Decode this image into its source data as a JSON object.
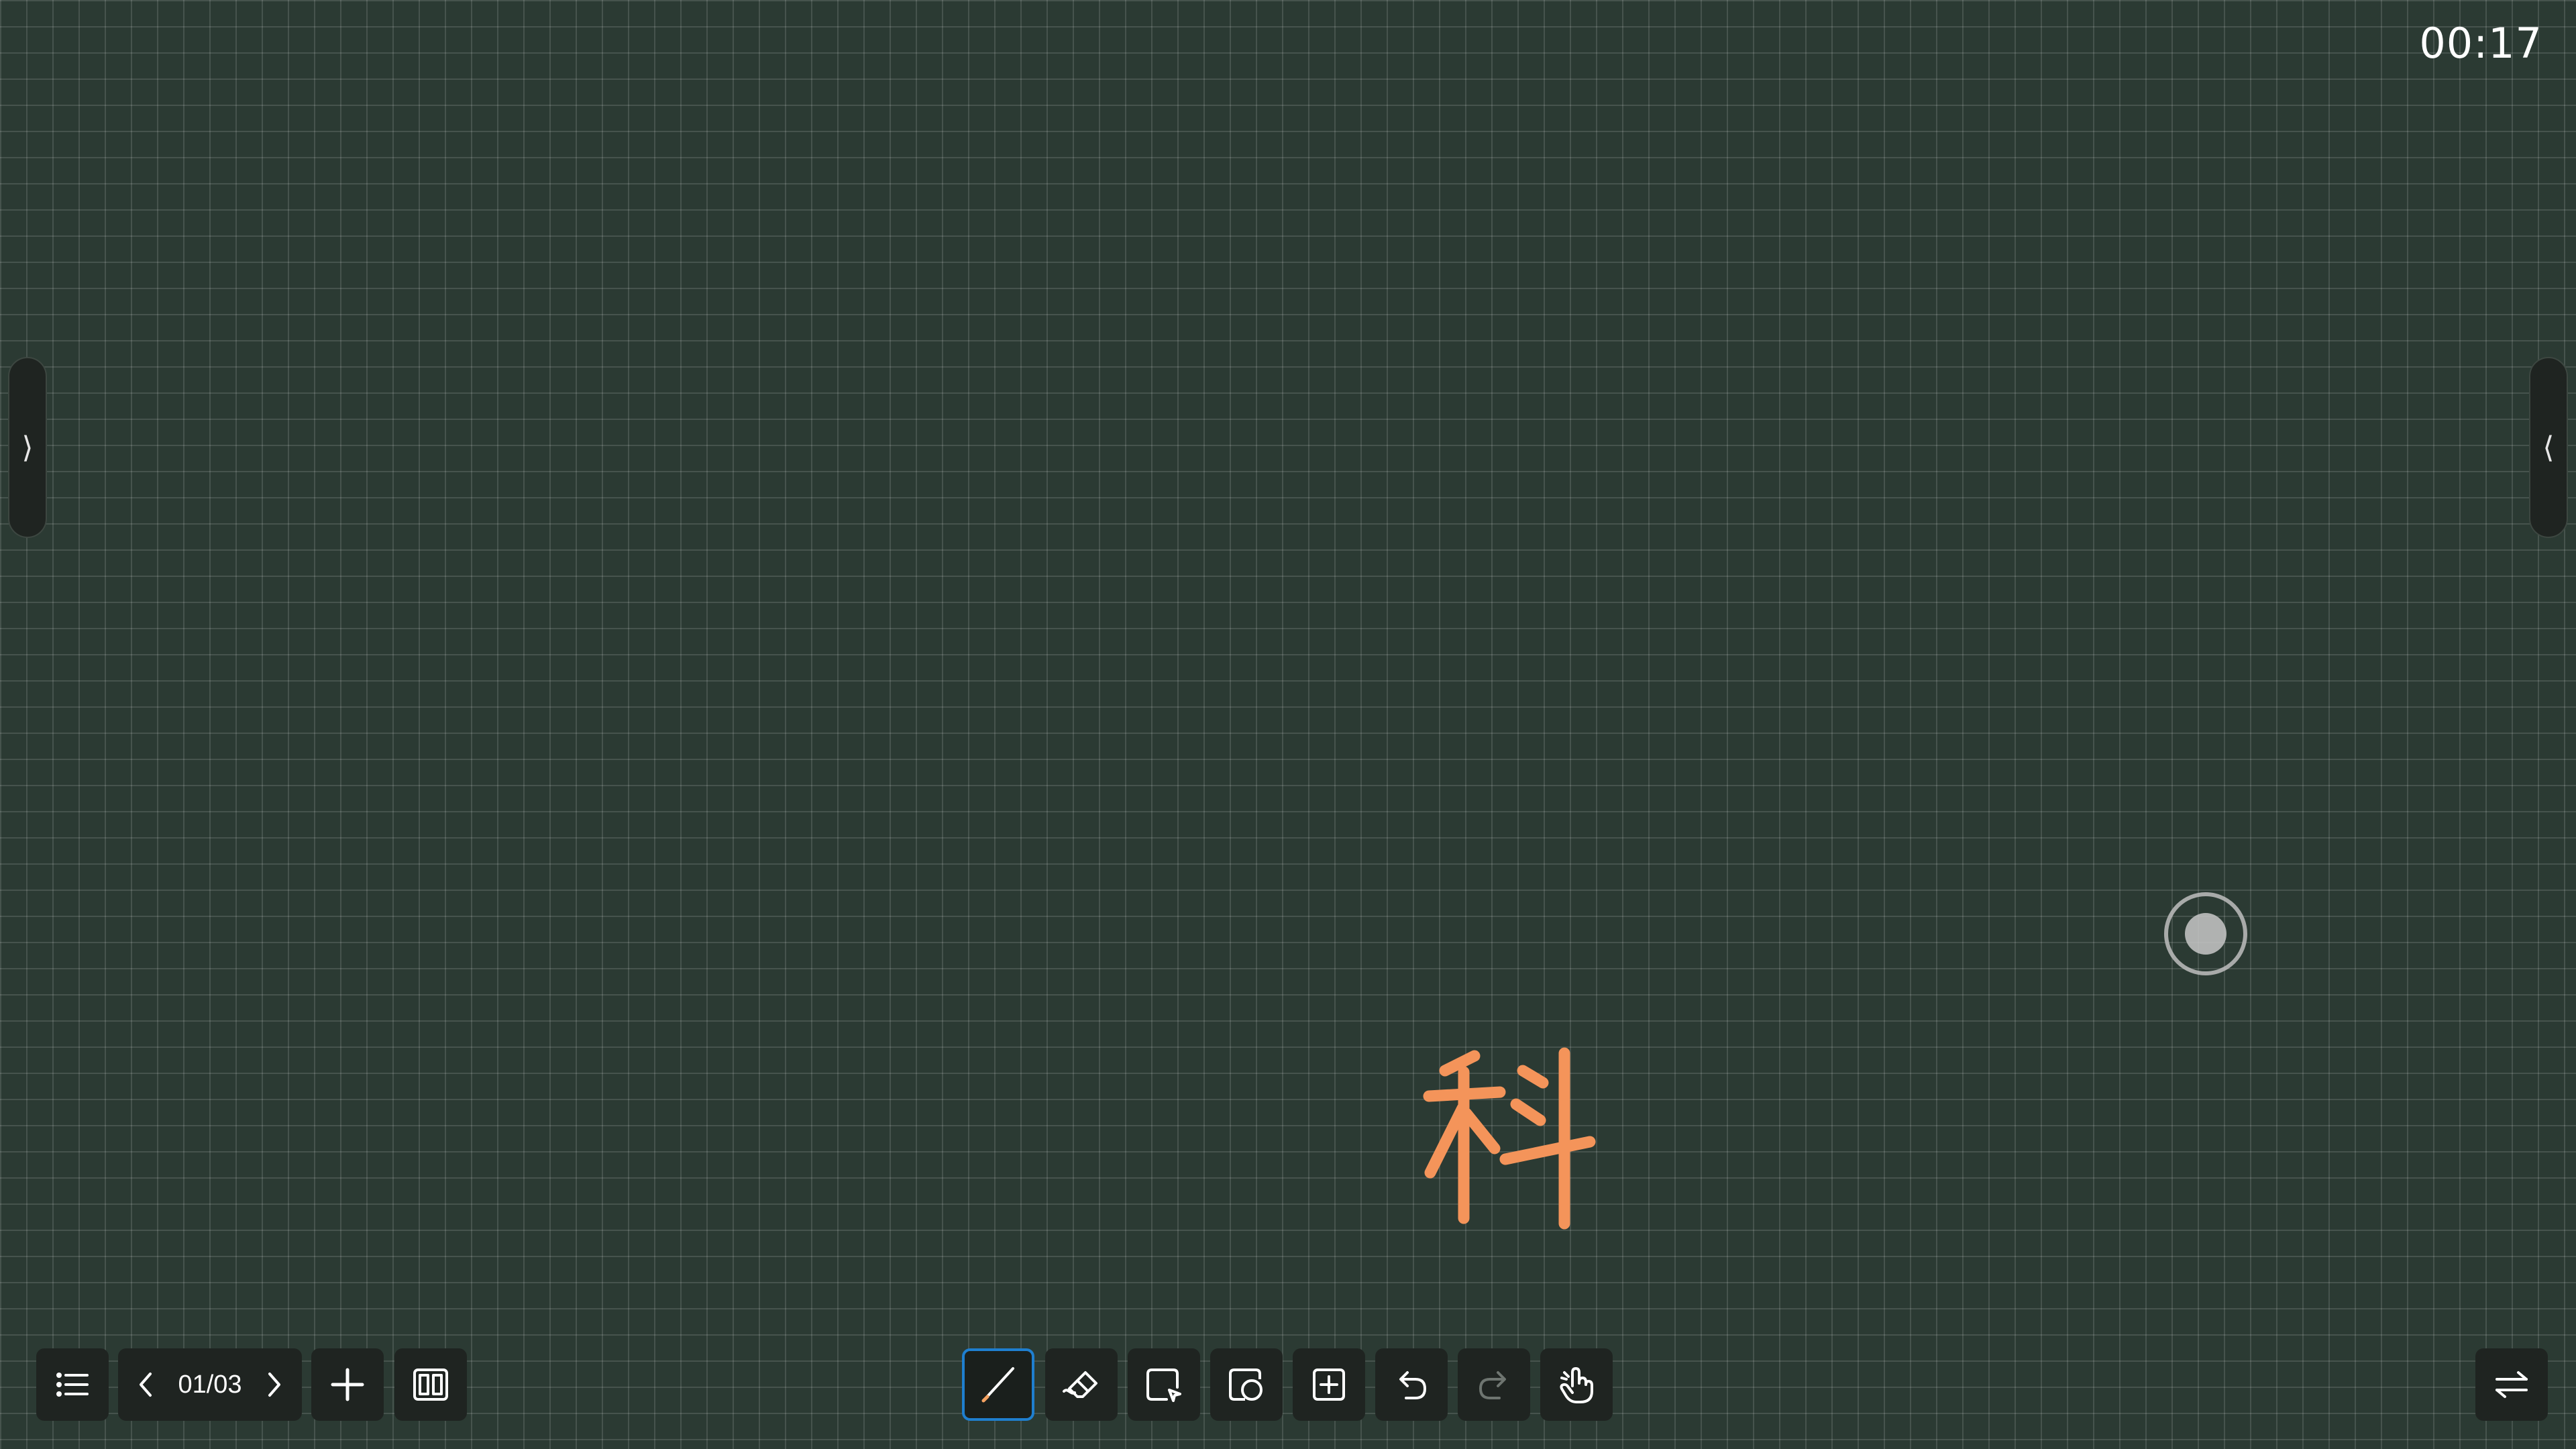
{
  "clock": {
    "time": "00:17"
  },
  "side_panels": {
    "left_handle_glyph": "⟩",
    "right_handle_glyph": "⟨"
  },
  "pager": {
    "current_page": "01/03"
  },
  "canvas": {
    "handwritten_text": "科",
    "ink_color": "#f4945a"
  },
  "toolbar": {
    "left": [
      "menu-icon",
      "previous-page-icon",
      "next-page-icon",
      "add-page-icon",
      "page-thumbnails-icon"
    ],
    "center": [
      "pen-icon",
      "eraser-icon",
      "select-icon",
      "shape-icon",
      "insert-icon",
      "undo-icon",
      "redo-icon",
      "gesture-icon"
    ],
    "right": [
      "switch-icon"
    ],
    "active_tool": "pen",
    "accent_color": "#1f7fcf"
  },
  "colors": {
    "board_background": "#2b3a33",
    "button_background": "#1f2421"
  }
}
